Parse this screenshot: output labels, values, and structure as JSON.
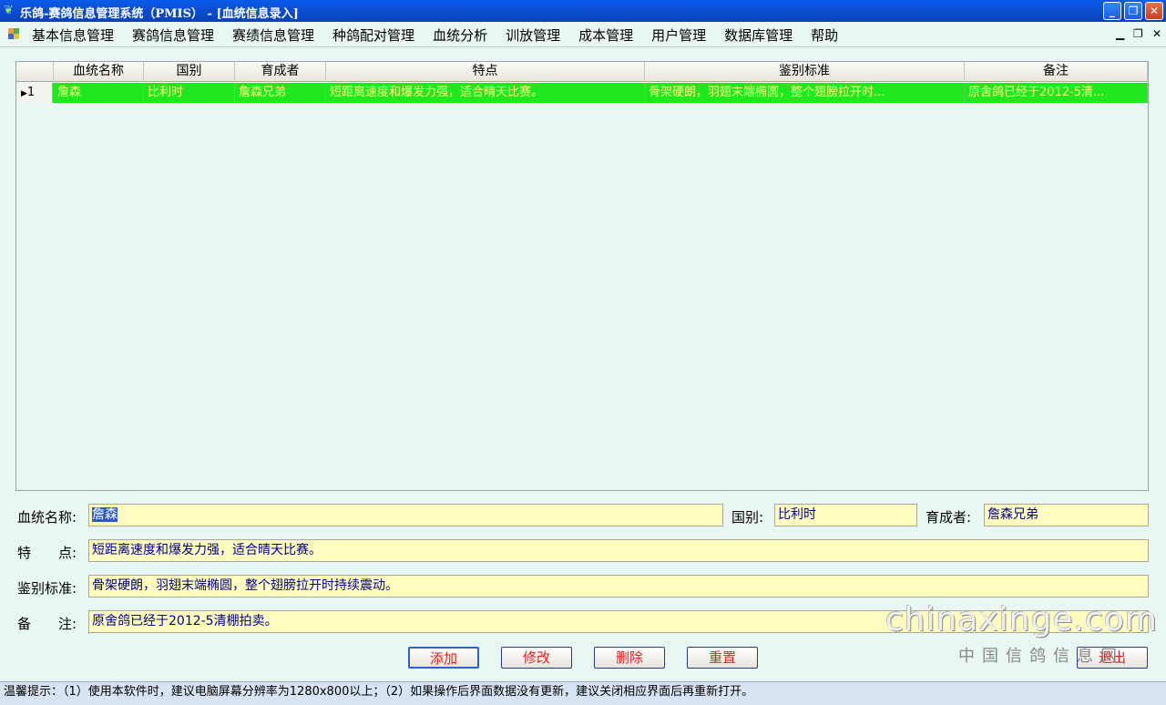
{
  "window": {
    "title": "乐鸽-赛鸽信息管理系统（PMIS） - [血统信息录入]"
  },
  "menu": {
    "items": [
      "基本信息管理",
      "赛鸽信息管理",
      "赛绩信息管理",
      "种鸽配对管理",
      "血统分析",
      "训放管理",
      "成本管理",
      "用户管理",
      "数据库管理",
      "帮助"
    ]
  },
  "grid": {
    "columns": [
      "血统名称",
      "国别",
      "育成者",
      "特点",
      "鉴别标准",
      "备注"
    ],
    "rows": [
      {
        "index": "1",
        "cells": [
          "詹森",
          "比利时",
          "詹森兄弟",
          "短距离速度和爆发力强，适合晴天比赛。",
          "骨架硬朗，羽翅末端椭圆，整个翅膀拉开时...",
          "原舍鸽已经于2012-5清..."
        ]
      }
    ]
  },
  "form": {
    "name_label": "血统名称:",
    "name_value": "詹森",
    "country_label": "国别:",
    "country_value": "比利时",
    "breeder_label": "育成者:",
    "breeder_value": "詹森兄弟",
    "feature_label": "特　　点:",
    "feature_value": "短距离速度和爆发力强，适合晴天比赛。",
    "standard_label": "鉴别标准:",
    "standard_value": "骨架硬朗，羽翅末端椭圆，整个翅膀拉开时持续震动。",
    "remark_label": "备　　注:",
    "remark_value": "原舍鸽已经于2012-5清棚拍卖。"
  },
  "buttons": {
    "add": "添加",
    "modify": "修改",
    "delete": "删除",
    "reset": "重置",
    "exit": "退出"
  },
  "watermark": {
    "text": "chinaxinge.com",
    "subtext": "中国信鸽信息网"
  },
  "status": {
    "text": "温馨提示：（1）使用本软件时，建议电脑屏幕分辨率为1280x800以上；（2）如果操作后界面数据没有更新，建议关闭相应界面后再重新打开。"
  },
  "icons": [
    "app-icon",
    "menu-icon",
    "minimize-icon",
    "restore-icon",
    "close-icon",
    "row-pointer-icon"
  ]
}
